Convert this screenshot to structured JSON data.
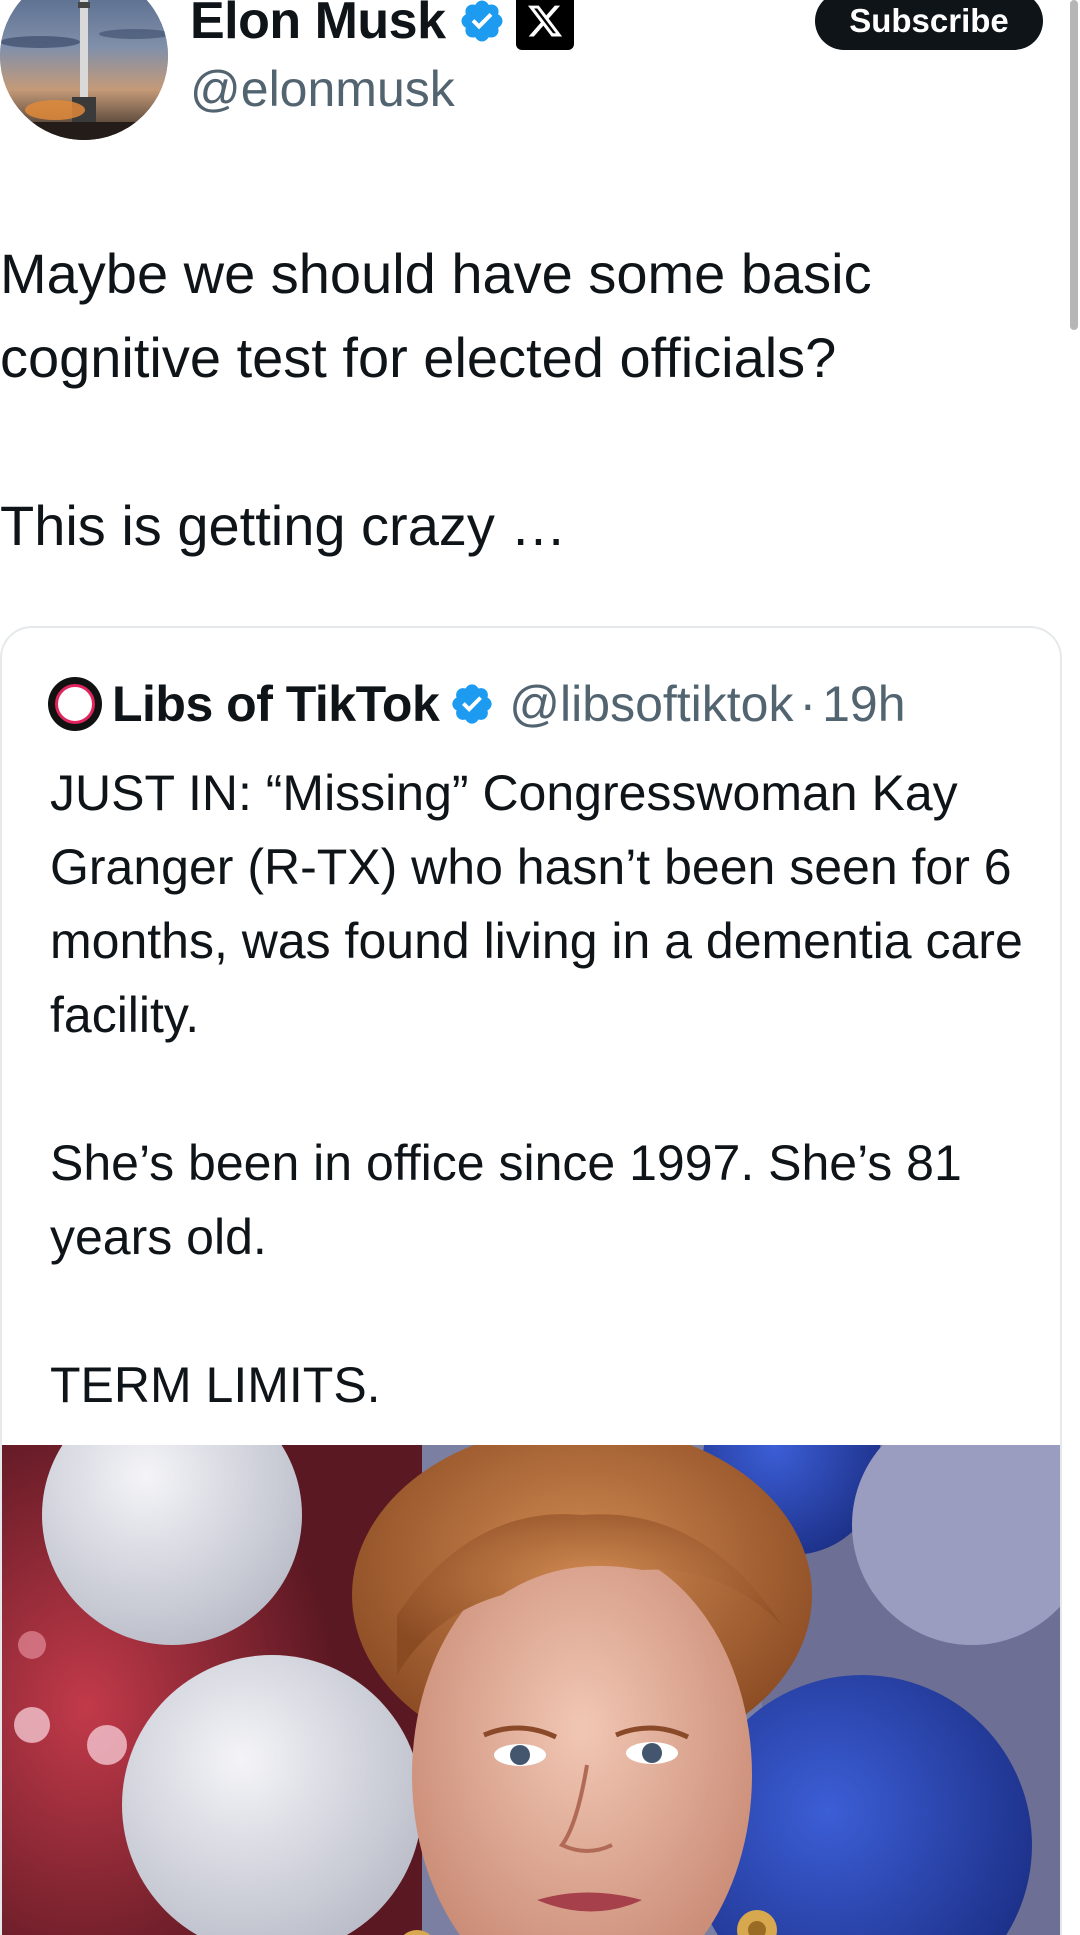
{
  "author": {
    "display_name": "Elon Musk",
    "handle": "@elonmusk",
    "avatar_icon": "rocket-launch-avatar",
    "verified_icon": "verified-badge-icon",
    "affiliate_icon": "x-logo-icon"
  },
  "actions": {
    "subscribe_label": "Subscribe"
  },
  "tweet": {
    "paragraphs": [
      "Maybe we should have some basic cognitive test for elected officials?",
      "This is getting crazy …"
    ]
  },
  "quoted_tweet": {
    "display_name": "Libs of TikTok",
    "handle": "@libsoftiktok",
    "separator": "·",
    "time": "19h",
    "verified_icon": "verified-badge-icon",
    "paragraphs": [
      "JUST IN: “Missing” Congresswoman Kay Granger (R-TX) who hasn’t been seen for 6 months, was found living in a dementia care facility.",
      "She’s been in office since 1997. She’s 81 years old.",
      "TERM LIMITS."
    ],
    "media": {
      "type": "photo",
      "subject": "woman-portrait-photo"
    }
  },
  "colors": {
    "text_primary": "#0f1419",
    "text_secondary": "#536471",
    "verified_blue": "#1d9bf0",
    "border": "#e6e9ec",
    "button_bg": "#0f1419"
  }
}
